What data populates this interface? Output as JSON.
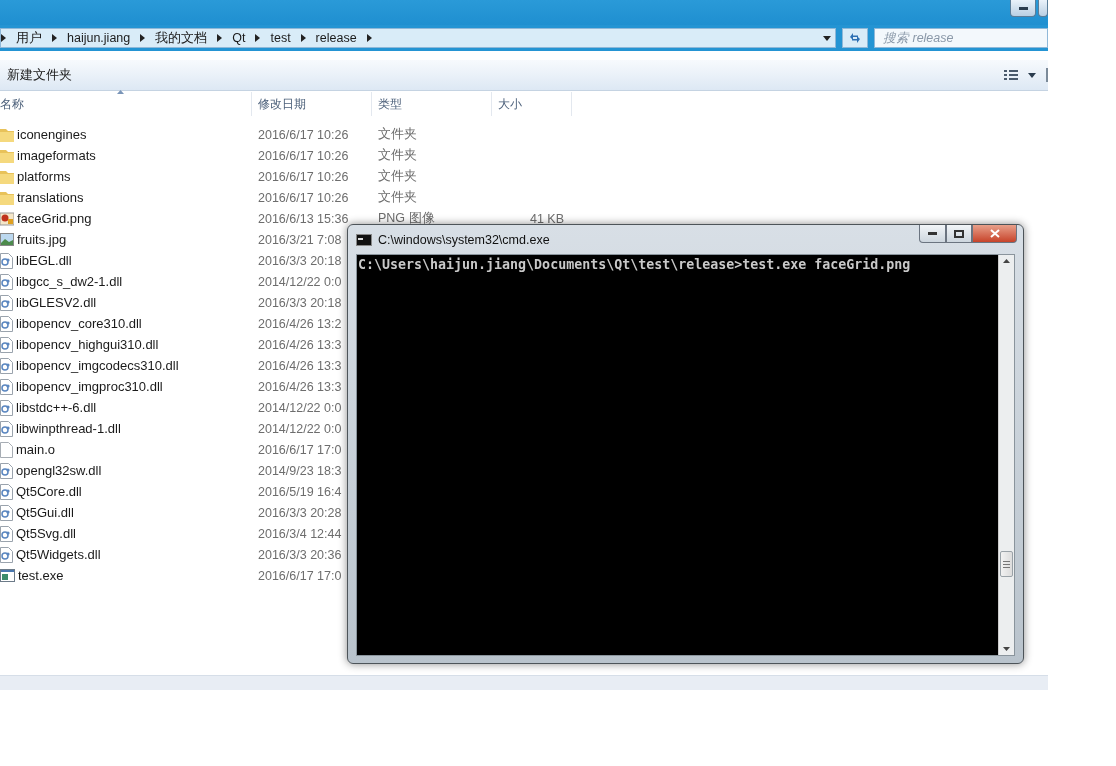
{
  "address_bar": {
    "path": [
      "用户",
      "haijun.jiang",
      "我的文档",
      "Qt",
      "test",
      "release"
    ]
  },
  "search": {
    "placeholder": "搜索 release"
  },
  "toolbar": {
    "new_folder": "新建文件夹"
  },
  "table": {
    "columns": [
      {
        "label": "名称",
        "sorted": true
      },
      {
        "label": "修改日期",
        "sorted": false
      },
      {
        "label": "类型",
        "sorted": false
      },
      {
        "label": "大小",
        "sorted": false
      }
    ],
    "rows": [
      {
        "kind": "folder",
        "name": "iconengines",
        "modified": "2016/6/17 10:26",
        "type": "文件夹"
      },
      {
        "kind": "folder",
        "name": "imageformats",
        "modified": "2016/6/17 10:26",
        "type": "文件夹"
      },
      {
        "kind": "folder",
        "name": "platforms",
        "modified": "2016/6/17 10:26",
        "type": "文件夹"
      },
      {
        "kind": "folder",
        "name": "translations",
        "modified": "2016/6/17 10:26",
        "type": "文件夹"
      },
      {
        "kind": "png",
        "name": "faceGrid.png",
        "modified": "2016/6/13 15:36",
        "type": "PNG 图像",
        "size": "41 KB"
      },
      {
        "kind": "jpg",
        "name": "fruits.jpg",
        "modified": "2016/3/21 7:08"
      },
      {
        "kind": "dll",
        "name": "libEGL.dll",
        "modified": "2016/3/3 20:18"
      },
      {
        "kind": "dll",
        "name": "libgcc_s_dw2-1.dll",
        "modified": "2014/12/22 0:0"
      },
      {
        "kind": "dll",
        "name": "libGLESV2.dll",
        "modified": "2016/3/3 20:18"
      },
      {
        "kind": "dll",
        "name": "libopencv_core310.dll",
        "modified": "2016/4/26 13:2"
      },
      {
        "kind": "dll",
        "name": "libopencv_highgui310.dll",
        "modified": "2016/4/26 13:3"
      },
      {
        "kind": "dll",
        "name": "libopencv_imgcodecs310.dll",
        "modified": "2016/4/26 13:3"
      },
      {
        "kind": "dll",
        "name": "libopencv_imgproc310.dll",
        "modified": "2016/4/26 13:3"
      },
      {
        "kind": "dll",
        "name": "libstdc++-6.dll",
        "modified": "2014/12/22 0:0"
      },
      {
        "kind": "dll",
        "name": "libwinpthread-1.dll",
        "modified": "2014/12/22 0:0"
      },
      {
        "kind": "file",
        "name": "main.o",
        "modified": "2016/6/17 17:0"
      },
      {
        "kind": "dll",
        "name": "opengl32sw.dll",
        "modified": "2014/9/23 18:3"
      },
      {
        "kind": "dll",
        "name": "Qt5Core.dll",
        "modified": "2016/5/19 16:4"
      },
      {
        "kind": "dll",
        "name": "Qt5Gui.dll",
        "modified": "2016/3/3 20:28"
      },
      {
        "kind": "dll",
        "name": "Qt5Svg.dll",
        "modified": "2016/3/4 12:44"
      },
      {
        "kind": "dll",
        "name": "Qt5Widgets.dll",
        "modified": "2016/3/3 20:36"
      },
      {
        "kind": "exe",
        "name": "test.exe",
        "modified": "2016/6/17 17:0"
      }
    ]
  },
  "console": {
    "title": "C:\\windows\\system32\\cmd.exe",
    "lines": [
      "C:\\Users\\haijun.jiang\\Documents\\Qt\\test\\release>test.exe faceGrid.png"
    ]
  }
}
